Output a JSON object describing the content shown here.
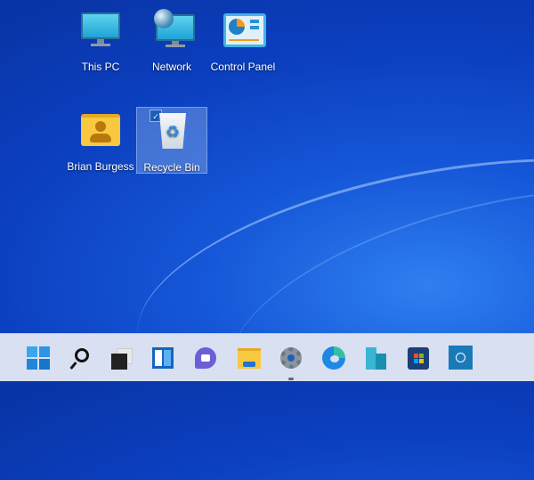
{
  "desktop": {
    "icons": [
      {
        "label": "This PC",
        "icon": "monitor-icon"
      },
      {
        "label": "Network",
        "icon": "network-globe-icon"
      },
      {
        "label": "Control Panel",
        "icon": "control-panel-icon"
      },
      {
        "label": "Brian Burgess",
        "icon": "user-folder-icon"
      },
      {
        "label": "Recycle Bin",
        "icon": "recycle-bin-icon",
        "selected": true
      }
    ]
  },
  "taskbar": {
    "items": [
      {
        "name": "Start",
        "icon": "windows-start-icon"
      },
      {
        "name": "Search",
        "icon": "search-icon"
      },
      {
        "name": "Task View",
        "icon": "task-view-icon"
      },
      {
        "name": "Widgets",
        "icon": "widgets-icon"
      },
      {
        "name": "Chat",
        "icon": "teams-chat-icon"
      },
      {
        "name": "File Explorer",
        "icon": "folder-icon"
      },
      {
        "name": "Settings",
        "icon": "gear-icon",
        "running": true
      },
      {
        "name": "Microsoft Edge",
        "icon": "edge-icon"
      },
      {
        "name": "Azure Data Studio",
        "icon": "buildings-icon"
      },
      {
        "name": "Microsoft Store",
        "icon": "store-icon"
      },
      {
        "name": "Dell",
        "icon": "dell-icon"
      }
    ]
  },
  "colors": {
    "accent": "#1f5fb8",
    "taskbar": "#d8e0f1"
  }
}
